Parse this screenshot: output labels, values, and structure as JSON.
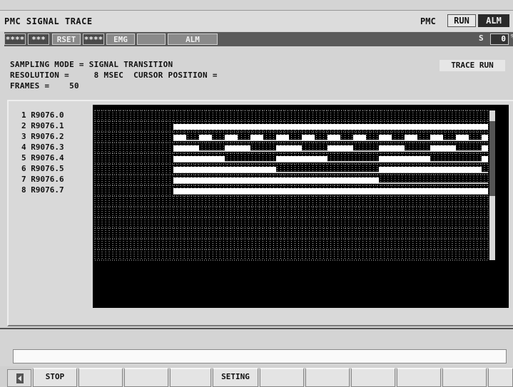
{
  "header": {
    "title": "PMC SIGNAL TRACE",
    "pmc_label": "PMC",
    "pmc_state": "RUN",
    "alarm": "ALM"
  },
  "status_bar": {
    "program_no": "****",
    "sequence_no": "***",
    "reset": "RSET",
    "motion": "****",
    "emergency": "EMG",
    "empty": "",
    "alarm": "ALM",
    "s_label": "S",
    "spindle_value": "0",
    "percent_sign": "%"
  },
  "info": {
    "sampling_mode_line": "SAMPLING MODE = SIGNAL TRANSITION",
    "resolution_line": "RESOLUTION =     8 MSEC  CURSOR POSITION =",
    "frames_line": "FRAMES =    50",
    "trace_status": "TRACE RUN"
  },
  "signals": [
    {
      "index": "1",
      "address": "R9076.0",
      "label": "1 R9076.0"
    },
    {
      "index": "2",
      "address": "R9076.1",
      "label": "2 R9076.1"
    },
    {
      "index": "3",
      "address": "R9076.2",
      "label": "3 R9076.2"
    },
    {
      "index": "4",
      "address": "R9076.3",
      "label": "4 R9076.3"
    },
    {
      "index": "5",
      "address": "R9076.4",
      "label": "5 R9076.4"
    },
    {
      "index": "6",
      "address": "R9076.5",
      "label": "6 R9076.5"
    },
    {
      "index": "7",
      "address": "R9076.6",
      "label": "7 R9076.6"
    },
    {
      "index": "8",
      "address": "R9076.7",
      "label": "8 R9076.7"
    }
  ],
  "trace": {
    "frames_shown": 50,
    "trace_start_frame": 10,
    "waveforms": [
      {
        "channel": 1,
        "high_from": null,
        "period": null
      },
      {
        "channel": 2,
        "high_from": 10,
        "period": null
      },
      {
        "channel": 3,
        "period": 2
      },
      {
        "channel": 4,
        "period": 4
      },
      {
        "channel": 5,
        "period": 8
      },
      {
        "channel": 6,
        "period": 16
      },
      {
        "channel": 7,
        "period": 32
      },
      {
        "channel": 8,
        "period": 64
      }
    ],
    "colors": {
      "background": "#000000",
      "grid": "#bdbdbd",
      "signal": "#ffffff",
      "cursor": "#d8d8d8"
    }
  },
  "message_line": "",
  "softkeys": {
    "prev": "prev-arrow",
    "keys": [
      "STOP",
      "",
      "",
      "",
      "SETING",
      "",
      "",
      "",
      "",
      "",
      ""
    ]
  }
}
